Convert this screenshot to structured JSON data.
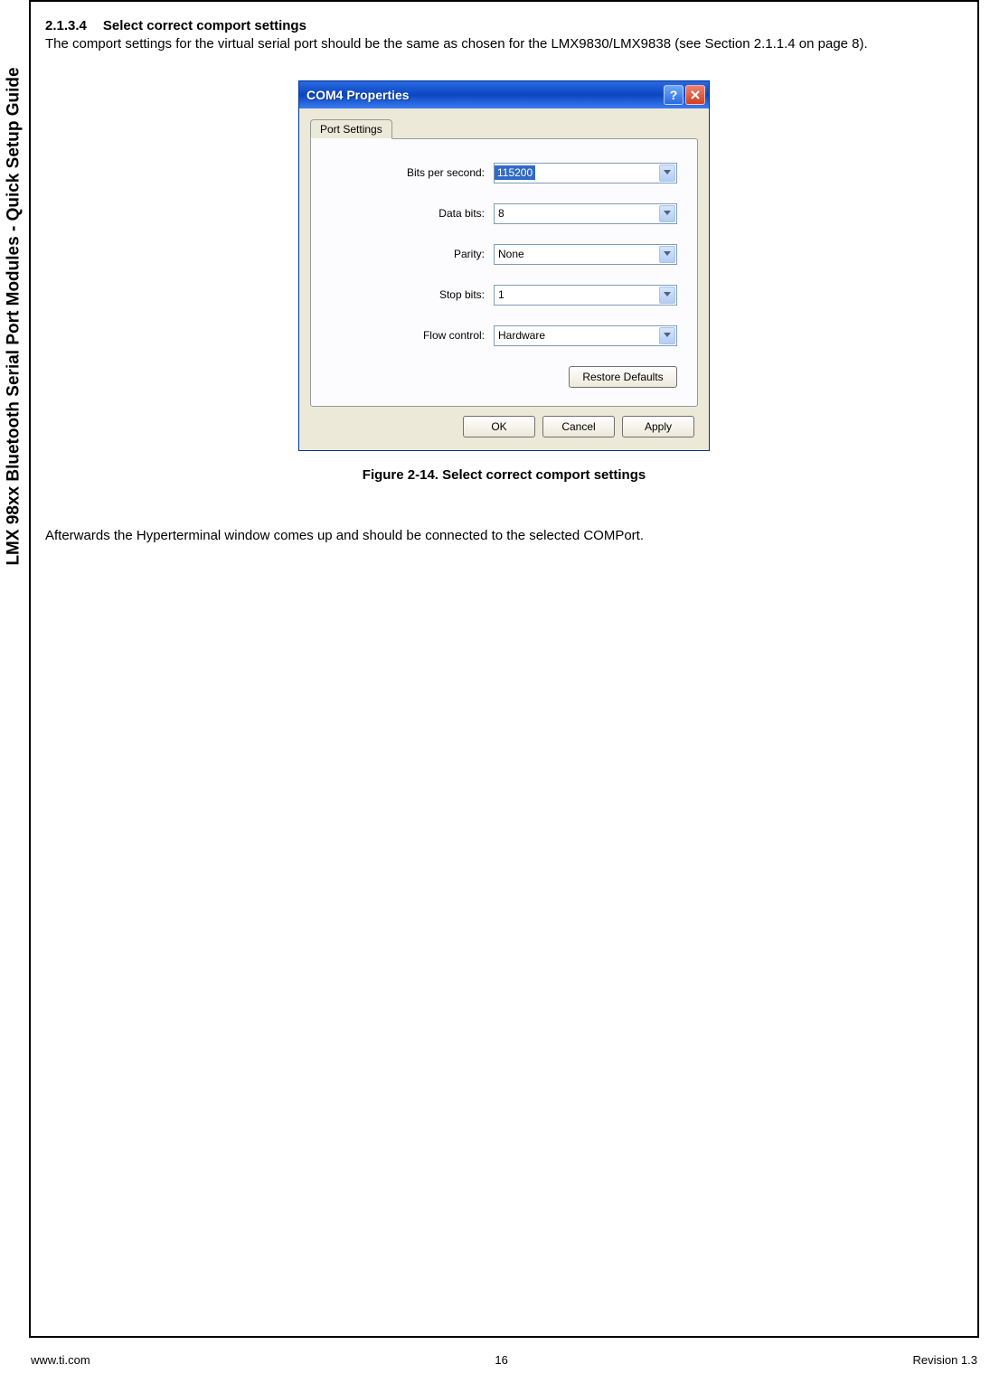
{
  "document": {
    "sidebar_title": "LMX 98xx Bluetooth Serial Port Modules - Quick Setup Guide",
    "section": {
      "number": "2.1.3.4",
      "title": "Select correct comport settings"
    },
    "body_text": "The comport settings for the virtual serial port should be the same as chosen for the LMX9830/LMX9838 (see Section 2.1.1.4 on page 8).",
    "figure_caption": "Figure 2-14.  Select correct comport settings",
    "followup_text": "Afterwards the Hyperterminal window comes up and should be connected to the selected COMPort."
  },
  "dialog": {
    "title": "COM4 Properties",
    "tab_label": "Port Settings",
    "fields": {
      "bits_per_second": {
        "label": "Bits per second:",
        "value": "115200"
      },
      "data_bits": {
        "label": "Data bits:",
        "value": "8"
      },
      "parity": {
        "label": "Parity:",
        "value": "None"
      },
      "stop_bits": {
        "label": "Stop bits:",
        "value": "1"
      },
      "flow_control": {
        "label": "Flow control:",
        "value": "Hardware"
      }
    },
    "buttons": {
      "restore_defaults": "Restore Defaults",
      "ok": "OK",
      "cancel": "Cancel",
      "apply": "Apply"
    }
  },
  "footer": {
    "url": "www.ti.com",
    "page_number": "16",
    "revision": "Revision 1.3"
  }
}
